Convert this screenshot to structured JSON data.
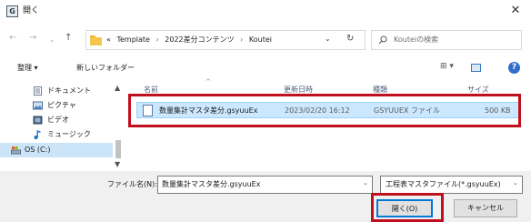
{
  "window": {
    "title": "開く",
    "app_icon_letter": "G"
  },
  "nav": {
    "back": "←",
    "forward": "→",
    "up": "↑",
    "recent": "⌄"
  },
  "address": {
    "prefix": "«",
    "crumbs": [
      "Template",
      "2022差分コンテンツ",
      "Koutei"
    ],
    "dropdown": "⌄",
    "refresh": "↻"
  },
  "search": {
    "placeholder": "Kouteiの検索"
  },
  "toolbar": {
    "organize": "整理 ▾",
    "new_folder": "新しいフォルダー",
    "view": "⊞ ▾",
    "help": "?"
  },
  "sidebar": {
    "items": [
      {
        "label": "ドキュメント",
        "icon": "document-icon"
      },
      {
        "label": "ピクチャ",
        "icon": "picture-icon"
      },
      {
        "label": "ビデオ",
        "icon": "video-icon"
      },
      {
        "label": "ミュージック",
        "icon": "music-icon"
      },
      {
        "label": "OS (C:)",
        "icon": "drive-icon",
        "selected": true
      }
    ]
  },
  "file_list": {
    "columns": [
      "名前",
      "更新日時",
      "種類",
      "サイズ"
    ],
    "rows": [
      {
        "name": "数量集計マスタ差分.gsyuuEx",
        "modified": "2023/02/20 16:12",
        "type": "GSYUUEX ファイル",
        "size": "500 KB"
      }
    ]
  },
  "bottom": {
    "filename_label": "ファイル名(N):",
    "filename_value": "数量集計マスタ差分.gsyuuEx",
    "filetype_value": "工程表マスタファイル(*.gsyuuEx)",
    "open_button": "開く(O)",
    "cancel_button": "キャンセル"
  },
  "colors": {
    "highlight": "#c0101f",
    "selection": "#cce8ff",
    "accent": "#0078d7"
  }
}
